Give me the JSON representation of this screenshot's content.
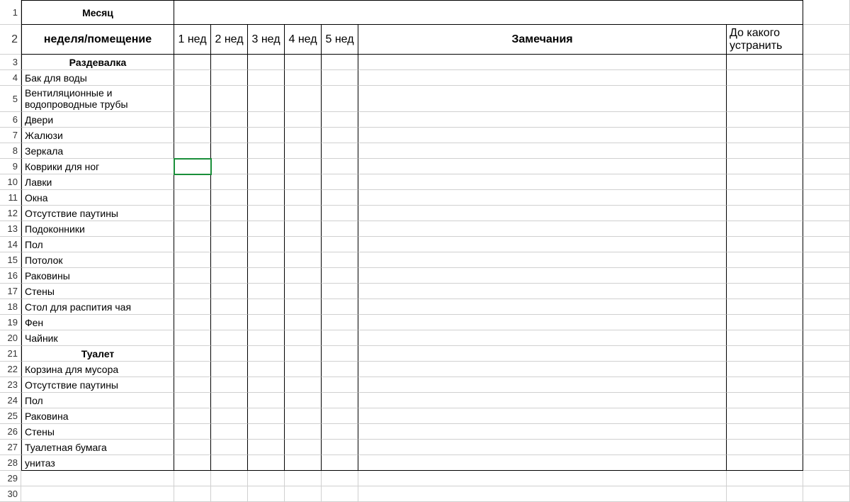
{
  "headers": {
    "month": "Месяц",
    "week_room": "неделя/помещение",
    "weeks": [
      "1 нед",
      "2 нед",
      "3 нед",
      "4 нед",
      "5 нед"
    ],
    "remarks": "Замечания",
    "fix_by": "До какого устранить"
  },
  "rows": [
    {
      "num": 3,
      "label": "Раздевалка",
      "section": true
    },
    {
      "num": 4,
      "label": "Бак для воды"
    },
    {
      "num": 5,
      "label": "Вентиляционные и водопроводные трубы",
      "tall": true
    },
    {
      "num": 6,
      "label": "Двери"
    },
    {
      "num": 7,
      "label": "Жалюзи"
    },
    {
      "num": 8,
      "label": "Зеркала"
    },
    {
      "num": 9,
      "label": "Коврики для ног",
      "selected": true
    },
    {
      "num": 10,
      "label": "Лавки"
    },
    {
      "num": 11,
      "label": "Окна"
    },
    {
      "num": 12,
      "label": "Отсутствие паутины"
    },
    {
      "num": 13,
      "label": "Подоконники"
    },
    {
      "num": 14,
      "label": "Пол"
    },
    {
      "num": 15,
      "label": "Потолок"
    },
    {
      "num": 16,
      "label": "Раковины"
    },
    {
      "num": 17,
      "label": "Стены"
    },
    {
      "num": 18,
      "label": "Стол для распития чая"
    },
    {
      "num": 19,
      "label": "Фен"
    },
    {
      "num": 20,
      "label": "Чайник"
    },
    {
      "num": 21,
      "label": "Туалет",
      "section": true
    },
    {
      "num": 22,
      "label": "Корзина для мусора"
    },
    {
      "num": 23,
      "label": "Отсутствие паутины"
    },
    {
      "num": 24,
      "label": "Пол"
    },
    {
      "num": 25,
      "label": "Раковина"
    },
    {
      "num": 26,
      "label": "Стены"
    },
    {
      "num": 27,
      "label": "Туалетная бумага"
    },
    {
      "num": 28,
      "label": "унитаз",
      "last": true
    }
  ],
  "empty_rows": [
    29,
    30
  ]
}
